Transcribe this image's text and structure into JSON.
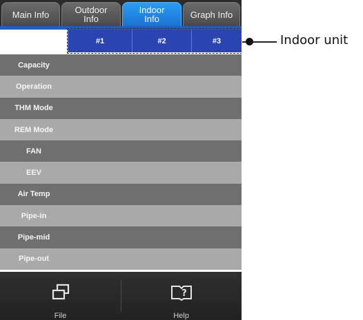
{
  "tabs": [
    {
      "label": "Main Info",
      "active": false
    },
    {
      "label": "Outdoor\nInfo",
      "active": false
    },
    {
      "label": "Indoor\nInfo",
      "active": true
    },
    {
      "label": "Graph Info",
      "active": false
    }
  ],
  "units": [
    "#1",
    "#2",
    "#3"
  ],
  "rows": [
    "Capacity",
    "Operation",
    "THM Mode",
    "REM Mode",
    "FAN",
    "EEV",
    "Air Temp",
    "Pipe-in",
    "Pipe-mid",
    "Pipe-out"
  ],
  "bottom": {
    "file_label": "File",
    "help_label": "Help",
    "file_icon": "windows-icon",
    "help_icon": "help-book-icon"
  },
  "callout": {
    "label": "Indoor unit"
  },
  "colors": {
    "active_tab": "#1a73d1",
    "unit_header": "#2a44b0",
    "row_dark": "#6f6f6f",
    "row_light": "#a9a9a9"
  }
}
